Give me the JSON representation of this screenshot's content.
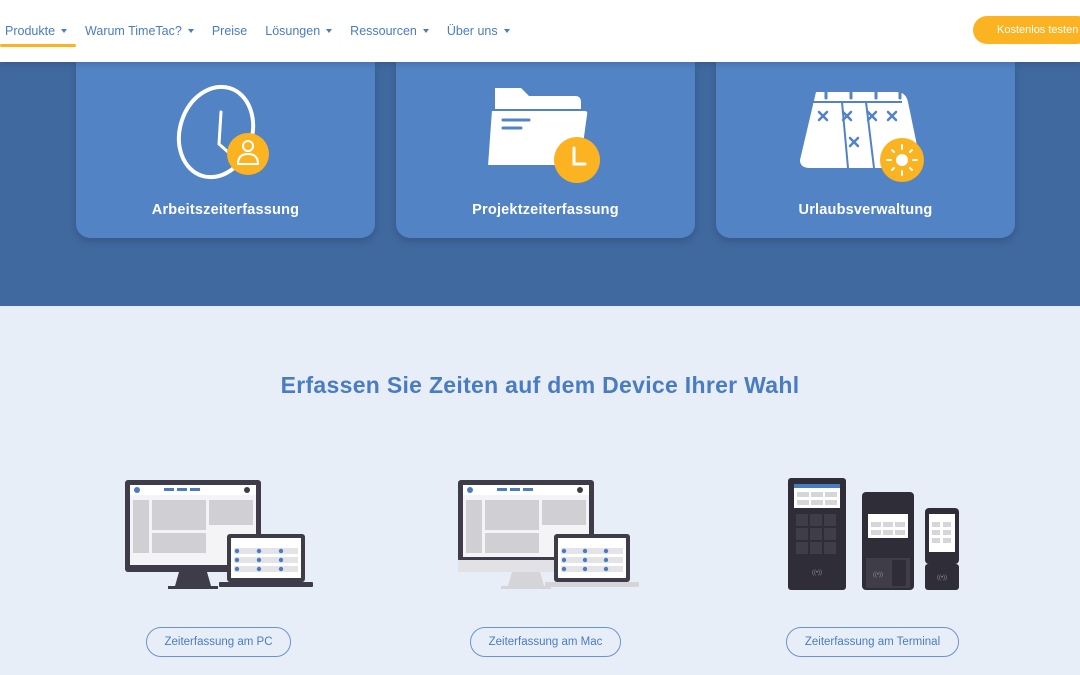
{
  "nav": {
    "items": [
      {
        "label": "Produkte",
        "dropdown": true,
        "active": true
      },
      {
        "label": "Warum TimeTac?",
        "dropdown": true,
        "active": false
      },
      {
        "label": "Preise",
        "dropdown": false,
        "active": false
      },
      {
        "label": "Lösungen",
        "dropdown": true,
        "active": false
      },
      {
        "label": "Ressourcen",
        "dropdown": true,
        "active": false
      },
      {
        "label": "Über uns",
        "dropdown": true,
        "active": false
      }
    ],
    "cta_label": "Kostenlos testen"
  },
  "products": [
    {
      "label": "Arbeitszeiterfassung",
      "icon": "clock-user-icon"
    },
    {
      "label": "Projektzeiterfassung",
      "icon": "folder-clock-icon"
    },
    {
      "label": "Urlaubsverwaltung",
      "icon": "calendar-sun-icon"
    }
  ],
  "devices": {
    "title": "Erfassen Sie Zeiten auf dem Device Ihrer Wahl",
    "items": [
      {
        "label": "Zeiterfassung am PC",
        "icon": "pc-laptop-icon"
      },
      {
        "label": "Zeiterfassung am Mac",
        "icon": "mac-laptop-icon"
      },
      {
        "label": "Zeiterfassung am Terminal",
        "icon": "terminal-devices-icon"
      }
    ]
  },
  "colors": {
    "accent": "#fbb321",
    "brand_blue": "#4a7cc2",
    "hero_bg": "#4069a0",
    "card_bg": "#5283c5",
    "section_bg": "#e7eef8"
  }
}
